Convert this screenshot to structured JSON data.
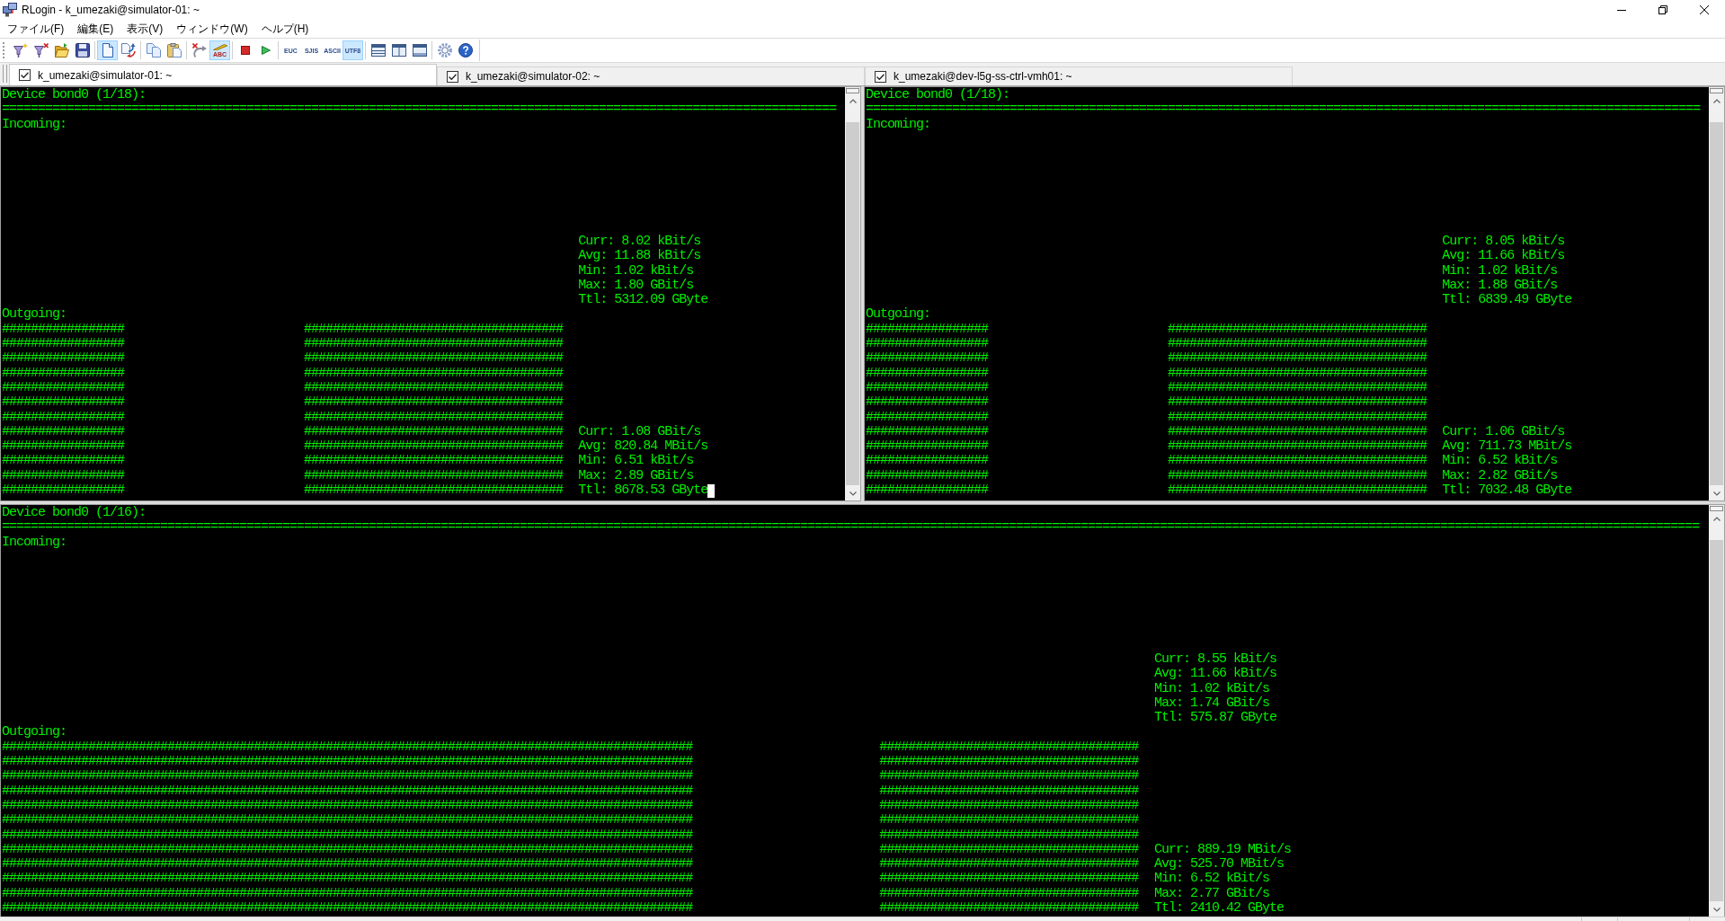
{
  "window": {
    "title": "RLogin - k_umezaki@simulator-01: ~"
  },
  "menu": [
    "ファイル(F)",
    "編集(E)",
    "表示(V)",
    "ウィンドウ(W)",
    "ヘルプ(H)"
  ],
  "toolbar": [
    [
      {
        "kind": "icon",
        "selected": false
      },
      {
        "kind": "icon",
        "selected": false
      },
      {
        "kind": "icon",
        "selected": false
      },
      {
        "kind": "icon",
        "selected": false
      }
    ],
    [
      {
        "kind": "icon",
        "selected": true
      },
      {
        "kind": "icon",
        "selected": false
      }
    ],
    [
      {
        "kind": "icon",
        "selected": false
      },
      {
        "kind": "icon",
        "selected": false
      }
    ],
    [
      {
        "kind": "icon",
        "selected": false
      },
      {
        "kind": "icon_text",
        "label": "ABC",
        "selected": true
      }
    ],
    [
      {
        "kind": "icon",
        "selected": false
      },
      {
        "kind": "icon",
        "selected": false
      }
    ],
    [
      {
        "kind": "text",
        "label": "EUC",
        "selected": false
      },
      {
        "kind": "text",
        "label": "SJIS",
        "selected": false
      },
      {
        "kind": "text",
        "label": "ASCII",
        "selected": false
      },
      {
        "kind": "text",
        "label": "UTF8",
        "selected": true
      }
    ],
    [
      {
        "kind": "icon",
        "selected": false
      },
      {
        "kind": "icon",
        "selected": false
      },
      {
        "kind": "icon",
        "selected": false
      }
    ],
    [
      {
        "kind": "icon",
        "selected": false
      },
      {
        "kind": "icon",
        "selected": false
      }
    ]
  ],
  "tabs": [
    {
      "label": "k_umezaki@simulator-01: ~",
      "checked": true,
      "selected": true
    },
    {
      "label": "k_umezaki@simulator-02: ~",
      "checked": true,
      "selected": false
    },
    {
      "label": "k_umezaki@dev-l5g-ss-ctrl-vmh01: ~",
      "checked": true,
      "selected": false
    }
  ],
  "terminal_rows": [
    [
      {
        "cursor": true,
        "device": "Device bond0 (1/18):",
        "rule": "====================================================================================================================",
        "sections": [
          {
            "label": "Incoming:",
            "stats": [
              "Curr: 8.02 kBit/s",
              "Avg: 11.88 kBit/s",
              "Min: 1.02 kBit/s",
              "Max: 1.80 GBit/s",
              "Ttl: 5312.09 GByte"
            ]
          },
          {
            "label": "Outgoing:",
            "graph_rows": [
              "#################                         ####################################",
              "#################                         ####################################",
              "#################                         ####################################",
              "#################                         ####################################",
              "#################                         ####################################",
              "#################                         ####################################",
              "#################                         ####################################",
              "#################                         ####################################",
              "#################                         ####################################",
              "#################                         ####################################",
              "#################                         ####################################",
              "#################                         ####################################"
            ],
            "stats": [
              "Curr: 1.08 GBit/s",
              "Avg: 820.84 MBit/s",
              "Min: 6.51 kBit/s",
              "Max: 2.89 GBit/s",
              "Ttl: 8678.53 GByte"
            ]
          }
        ]
      },
      {
        "cursor": false,
        "device": "Device bond0 (1/18):",
        "rule": "====================================================================================================================",
        "sections": [
          {
            "label": "Incoming:",
            "stats": [
              "Curr: 8.05 kBit/s",
              "Avg: 11.66 kBit/s",
              "Min: 1.02 kBit/s",
              "Max: 1.88 GBit/s",
              "Ttl: 6839.49 GByte"
            ]
          },
          {
            "label": "Outgoing:",
            "graph_rows": [
              "#################                         ####################################",
              "#################                         ####################################",
              "#################                         ####################################",
              "#################                         ####################################",
              "#################                         ####################################",
              "#################                         ####################################",
              "#################                         ####################################",
              "#################                         ####################################",
              "#################                         ####################################",
              "#################                         ####################################",
              "#################                         ####################################",
              "#################                         ####################################"
            ],
            "stats": [
              "Curr: 1.06 GBit/s",
              "Avg: 711.73 MBit/s",
              "Min: 6.52 kBit/s",
              "Max: 2.82 GBit/s",
              "Ttl: 7032.48 GByte"
            ]
          }
        ]
      }
    ],
    [
      {
        "cursor": false,
        "device": "Device bond0 (1/16):",
        "rule": "============================================================================================================================================================================================================================================",
        "sections": [
          {
            "label": "Incoming:",
            "stats": [
              "Curr: 8.55 kBit/s",
              "Avg: 11.66 kBit/s",
              "Min: 1.02 kBit/s",
              "Max: 1.74 GBit/s",
              "Ttl: 575.87 GByte"
            ]
          },
          {
            "label": "Outgoing:",
            "graph_rows": [
              "################################################################################################                          ####################################",
              "################################################################################################                          ####################################",
              "################################################################################################                          ####################################",
              "################################################################################################                          ####################################",
              "################################################################################################                          ####################################",
              "################################################################################################                          ####################################",
              "################################################################################################                          ####################################",
              "################################################################################################                          ####################################",
              "################################################################################################                          ####################################",
              "################################################################################################                          ####################################",
              "################################################################################################                          ####################################",
              "################################################################################################                          ####################################"
            ],
            "stats": [
              "Curr: 889.19 MBit/s",
              "Avg: 525.70 MBit/s",
              "Min: 6.52 kBit/s",
              "Max: 2.77 GBit/s",
              "Ttl: 2410.42 GByte"
            ]
          }
        ]
      }
    ]
  ]
}
